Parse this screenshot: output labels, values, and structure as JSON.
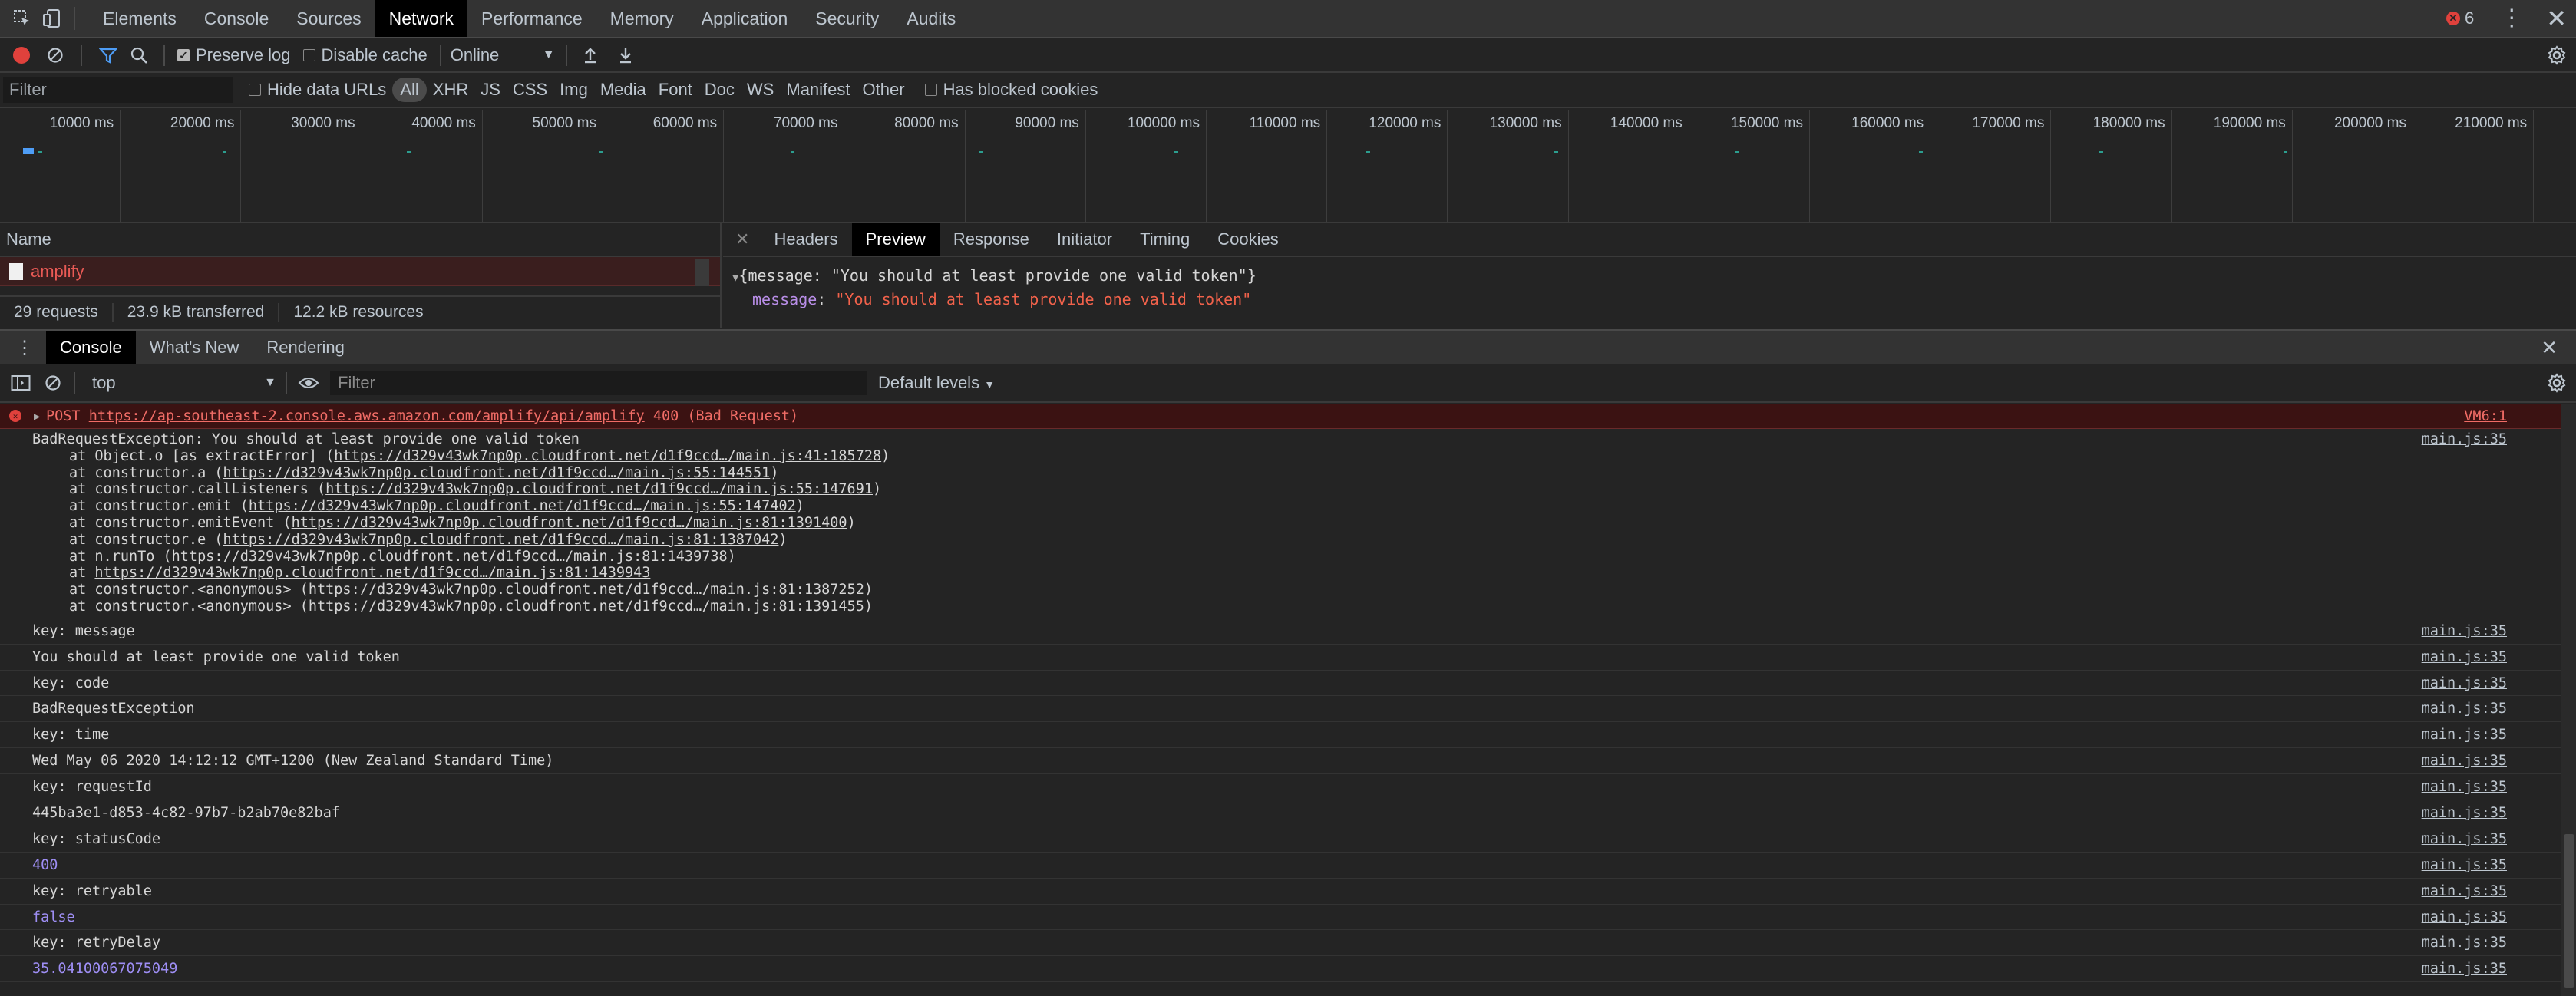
{
  "tabs": [
    "Elements",
    "Console",
    "Sources",
    "Network",
    "Performance",
    "Memory",
    "Application",
    "Security",
    "Audits"
  ],
  "active_tab_index": 3,
  "error_count": "6",
  "net_toolbar": {
    "preserve_log": "Preserve log",
    "disable_cache": "Disable cache",
    "throttle": "Online"
  },
  "filter_bar": {
    "filter_placeholder": "Filter",
    "hide_data_urls": "Hide data URLs",
    "types": [
      "All",
      "XHR",
      "JS",
      "CSS",
      "Img",
      "Media",
      "Font",
      "Doc",
      "WS",
      "Manifest",
      "Other"
    ],
    "has_blocked_cookies": "Has blocked cookies"
  },
  "timeline": {
    "ticks": [
      "10000 ms",
      "20000 ms",
      "30000 ms",
      "40000 ms",
      "50000 ms",
      "60000 ms",
      "70000 ms",
      "80000 ms",
      "90000 ms",
      "100000 ms",
      "110000 ms",
      "120000 ms",
      "130000 ms",
      "140000 ms",
      "150000 ms",
      "160000 ms",
      "170000 ms",
      "180000 ms",
      "190000 ms",
      "200000 ms",
      "210000 ms"
    ]
  },
  "requests": {
    "header": "Name",
    "rows": [
      "amplify"
    ],
    "summary": [
      "29 requests",
      "23.9 kB transferred",
      "12.2 kB resources"
    ]
  },
  "details": {
    "tabs": [
      "Headers",
      "Preview",
      "Response",
      "Initiator",
      "Timing",
      "Cookies"
    ],
    "active_tab_index": 1,
    "preview_summary": "{message: \"You should at least provide one valid token\"}",
    "preview_key": "message",
    "preview_value": "\"You should at least provide one valid token\""
  },
  "drawer": {
    "tabs": [
      "Console",
      "What's New",
      "Rendering"
    ],
    "active_tab_index": 0
  },
  "console_toolbar": {
    "context": "top",
    "filter_placeholder": "Filter",
    "levels": "Default levels"
  },
  "console": {
    "error_line": {
      "method": "POST",
      "url": "https://ap-southeast-2.console.aws.amazon.com/amplify/api/amplify",
      "status": "400 (Bad Request)",
      "source": "VM6:1"
    },
    "exception": {
      "title": "BadRequestException: You should at least provide one valid token",
      "source": "main.js:35",
      "stack": [
        {
          "prefix": "at Object.o [as extractError] (",
          "url": "https://d329v43wk7np0p.cloudfront.net/d1f9ccd…/main.js:41:185728",
          "suffix": ")"
        },
        {
          "prefix": "at constructor.a (",
          "url": "https://d329v43wk7np0p.cloudfront.net/d1f9ccd…/main.js:55:144551",
          "suffix": ")"
        },
        {
          "prefix": "at constructor.callListeners (",
          "url": "https://d329v43wk7np0p.cloudfront.net/d1f9ccd…/main.js:55:147691",
          "suffix": ")"
        },
        {
          "prefix": "at constructor.emit (",
          "url": "https://d329v43wk7np0p.cloudfront.net/d1f9ccd…/main.js:55:147402",
          "suffix": ")"
        },
        {
          "prefix": "at constructor.emitEvent (",
          "url": "https://d329v43wk7np0p.cloudfront.net/d1f9ccd…/main.js:81:1391400",
          "suffix": ")"
        },
        {
          "prefix": "at constructor.e (",
          "url": "https://d329v43wk7np0p.cloudfront.net/d1f9ccd…/main.js:81:1387042",
          "suffix": ")"
        },
        {
          "prefix": "at n.runTo (",
          "url": "https://d329v43wk7np0p.cloudfront.net/d1f9ccd…/main.js:81:1439738",
          "suffix": ")"
        },
        {
          "prefix": "at ",
          "url": "https://d329v43wk7np0p.cloudfront.net/d1f9ccd…/main.js:81:1439943",
          "suffix": ""
        },
        {
          "prefix": "at constructor.<anonymous> (",
          "url": "https://d329v43wk7np0p.cloudfront.net/d1f9ccd…/main.js:81:1387252",
          "suffix": ")"
        },
        {
          "prefix": "at constructor.<anonymous> (",
          "url": "https://d329v43wk7np0p.cloudfront.net/d1f9ccd…/main.js:81:1391455",
          "suffix": ")"
        }
      ]
    },
    "lines": [
      {
        "text": "key: message",
        "kind": "plain",
        "source": "main.js:35"
      },
      {
        "text": "You should at least provide one valid token",
        "kind": "plain",
        "source": "main.js:35"
      },
      {
        "text": "key: code",
        "kind": "plain",
        "source": "main.js:35"
      },
      {
        "text": "BadRequestException",
        "kind": "plain",
        "source": "main.js:35"
      },
      {
        "text": "key: time",
        "kind": "plain",
        "source": "main.js:35"
      },
      {
        "text": "Wed May 06 2020 14:12:12 GMT+1200 (New Zealand Standard Time)",
        "kind": "plain",
        "source": "main.js:35"
      },
      {
        "text": "key: requestId",
        "kind": "plain",
        "source": "main.js:35"
      },
      {
        "text": "445ba3e1-d853-4c82-97b7-b2ab70e82baf",
        "kind": "plain",
        "source": "main.js:35"
      },
      {
        "text": "key: statusCode",
        "kind": "plain",
        "source": "main.js:35"
      },
      {
        "text": "400",
        "kind": "num",
        "source": "main.js:35"
      },
      {
        "text": "key: retryable",
        "kind": "plain",
        "source": "main.js:35"
      },
      {
        "text": "false",
        "kind": "num",
        "source": "main.js:35"
      },
      {
        "text": "key: retryDelay",
        "kind": "plain",
        "source": "main.js:35"
      },
      {
        "text": "35.04100067075049",
        "kind": "num",
        "source": "main.js:35"
      }
    ]
  },
  "colors": {
    "error_red": "#e0413c",
    "accent_blue": "#4e9df6",
    "number_purple": "#9e8ef4"
  }
}
